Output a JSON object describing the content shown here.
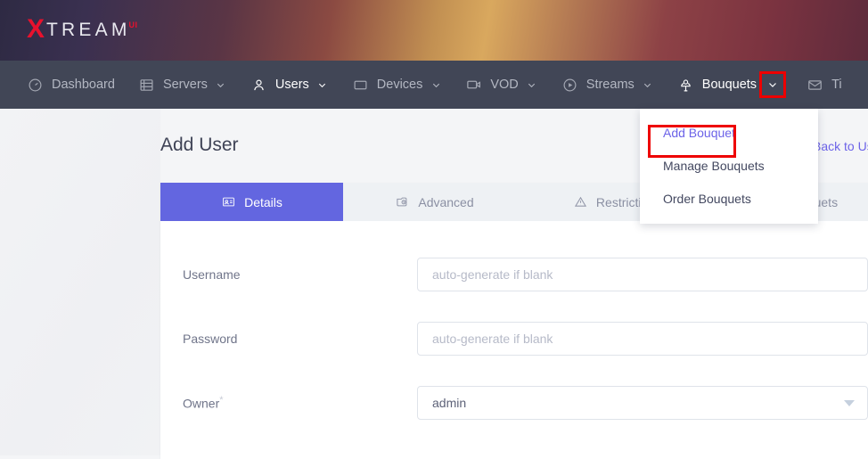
{
  "brand": {
    "logo_x": "X",
    "logo_rest": "TREAM",
    "logo_sup": "UI"
  },
  "nav": {
    "items": [
      {
        "label": "Dashboard",
        "icon": "dashboard-icon",
        "chevron": false,
        "active": false,
        "caret": false,
        "boxed": false
      },
      {
        "label": "Servers",
        "icon": "servers-icon",
        "chevron": true,
        "active": false,
        "caret": false,
        "boxed": false
      },
      {
        "label": "Users",
        "icon": "users-icon",
        "chevron": true,
        "active": true,
        "caret": true,
        "boxed": false
      },
      {
        "label": "Devices",
        "icon": "devices-icon",
        "chevron": true,
        "active": false,
        "caret": false,
        "boxed": false
      },
      {
        "label": "VOD",
        "icon": "vod-icon",
        "chevron": true,
        "active": false,
        "caret": false,
        "boxed": false
      },
      {
        "label": "Streams",
        "icon": "streams-icon",
        "chevron": true,
        "active": false,
        "caret": false,
        "boxed": false
      },
      {
        "label": "Bouquets",
        "icon": "bouquets-icon",
        "chevron": true,
        "active": true,
        "caret": false,
        "boxed": true
      },
      {
        "label": "Ti",
        "icon": "tickets-icon",
        "chevron": false,
        "active": false,
        "caret": false,
        "boxed": false
      }
    ]
  },
  "dropdown": {
    "items": [
      {
        "label": "Add Bouquet",
        "highlight": true
      },
      {
        "label": "Manage Bouquets",
        "highlight": false
      },
      {
        "label": "Order Bouquets",
        "highlight": false
      }
    ]
  },
  "page": {
    "title": "Add User",
    "back_link": "Back to Users"
  },
  "tabs": [
    {
      "label": "Details",
      "icon": "details-card-icon",
      "active": true
    },
    {
      "label": "Advanced",
      "icon": "advanced-gear-icon",
      "active": false
    },
    {
      "label": "Restrictions",
      "icon": "restrictions-warning-icon",
      "active": false
    },
    {
      "label": "Bouquets",
      "icon": "bouquets-tab-icon",
      "active": false
    }
  ],
  "form": {
    "fields": [
      {
        "label": "Username",
        "required": false,
        "type": "text",
        "value": "",
        "placeholder": "auto-generate if blank"
      },
      {
        "label": "Password",
        "required": false,
        "type": "text",
        "value": "",
        "placeholder": "auto-generate if blank"
      },
      {
        "label": "Owner",
        "required": true,
        "type": "select",
        "value": "admin",
        "placeholder": ""
      }
    ]
  },
  "colors": {
    "accent": "#6366e0",
    "nav_bg": "#414656",
    "highlight_box": "#ee0000",
    "link": "#6c63e8"
  }
}
